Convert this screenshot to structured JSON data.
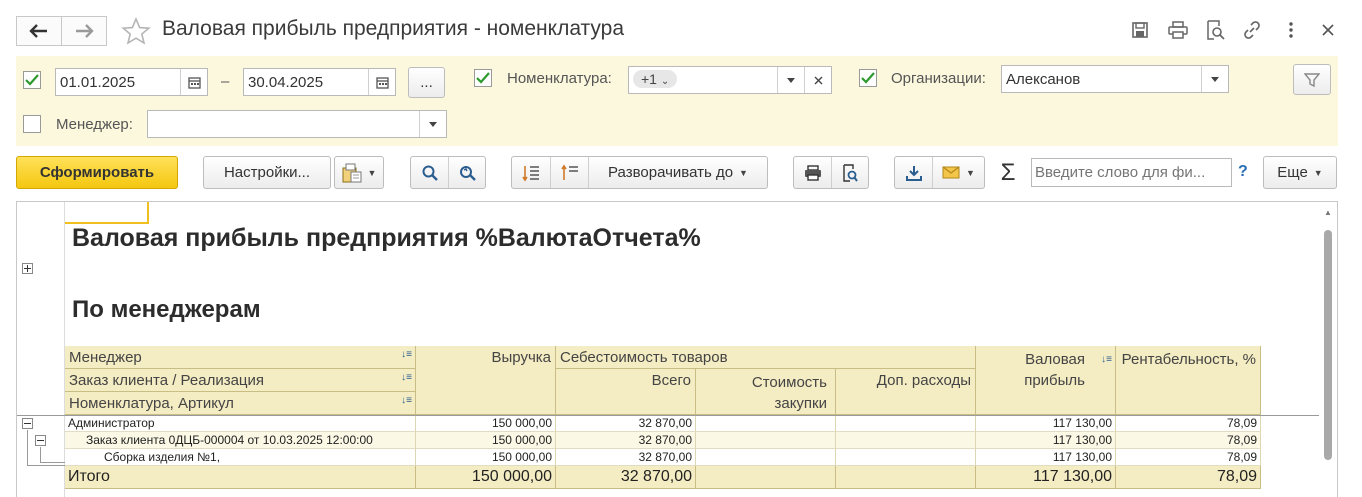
{
  "window": {
    "title": "Валовая прибыль предприятия - номенклатура"
  },
  "filters": {
    "period": {
      "checked": true,
      "from": "01.01.2025",
      "separator": "–",
      "to": "30.04.2025",
      "more_label": "..."
    },
    "nomenclature": {
      "checked": true,
      "label": "Номенклатура:",
      "value": "+1"
    },
    "organizations": {
      "checked": true,
      "label": "Организации:",
      "value": "Алексанов"
    },
    "manager": {
      "checked": false,
      "label": "Менеджер:",
      "value": ""
    }
  },
  "toolbar": {
    "generate_label": "Сформировать",
    "settings_label": "Настройки...",
    "expand_label": "Разворачивать до",
    "search_placeholder": "Введите слово для фи...",
    "help_label": "?",
    "more_label": "Еще",
    "sigma": "Σ"
  },
  "report": {
    "title": "Валовая прибыль предприятия %ВалютаОтчета%",
    "subtitle": "По менеджерам",
    "headers": {
      "group1": "Менеджер",
      "group2": "Заказ клиента / Реализация",
      "group3": "Номенклатура, Артикул",
      "revenue": "Выручка",
      "cost": "Себестоимость товаров",
      "cost_total": "Всего",
      "cost_purchase": "Стоимость закупки",
      "cost_extra": "Доп. расходы",
      "gross_profit": "Валовая прибыль",
      "profitability": "Рентабельность, %"
    },
    "rows": [
      {
        "name": "Администратор",
        "revenue": "150 000,00",
        "cost_total": "32 870,00",
        "cost_purchase": "",
        "cost_extra": "",
        "gross": "117 130,00",
        "profit": "78,09"
      },
      {
        "name": "Заказ клиента 0ДЦБ-000004 от 10.03.2025 12:00:00",
        "revenue": "150 000,00",
        "cost_total": "32 870,00",
        "cost_purchase": "",
        "cost_extra": "",
        "gross": "117 130,00",
        "profit": "78,09"
      },
      {
        "name": "Сборка изделия №1,",
        "revenue": "150 000,00",
        "cost_total": "32 870,00",
        "cost_purchase": "",
        "cost_extra": "",
        "gross": "117 130,00",
        "profit": "78,09"
      }
    ],
    "total": {
      "name": "Итого",
      "revenue": "150 000,00",
      "cost_total": "32 870,00",
      "gross": "117 130,00",
      "profit": "78,09"
    }
  },
  "colors": {
    "filter_bg": "#fcf8dd",
    "header_bg": "#f4ecc2",
    "primary_button": "#f4c70f",
    "check_green": "#2e9a2e"
  }
}
